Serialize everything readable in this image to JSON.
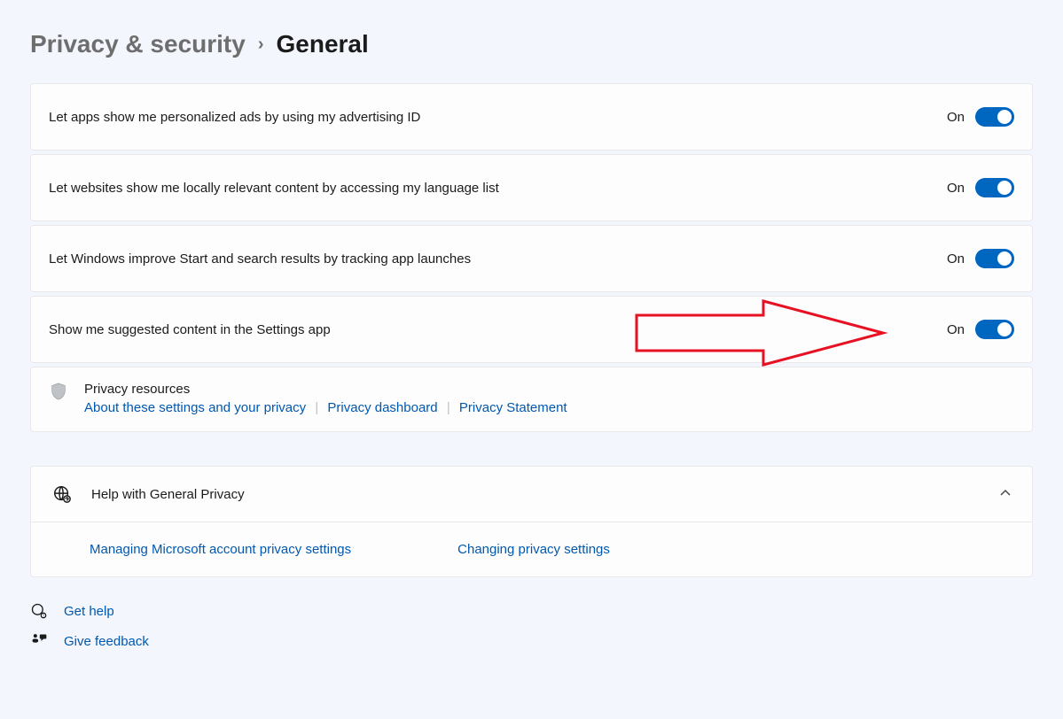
{
  "breadcrumb": {
    "parent": "Privacy & security",
    "current": "General"
  },
  "settings": [
    {
      "label": "Let apps show me personalized ads by using my advertising ID",
      "state": "On",
      "on": true,
      "name": "advertising-id"
    },
    {
      "label": "Let websites show me locally relevant content by accessing my language list",
      "state": "On",
      "on": true,
      "name": "language-list"
    },
    {
      "label": "Let Windows improve Start and search results by tracking app launches",
      "state": "On",
      "on": true,
      "name": "track-app-launches"
    },
    {
      "label": "Show me suggested content in the Settings app",
      "state": "On",
      "on": true,
      "name": "suggested-content"
    }
  ],
  "resources": {
    "title": "Privacy resources",
    "links": [
      "About these settings and your privacy",
      "Privacy dashboard",
      "Privacy Statement"
    ]
  },
  "help": {
    "title": "Help with General Privacy",
    "links": [
      "Managing Microsoft account privacy settings",
      "Changing privacy settings"
    ]
  },
  "footer": {
    "get_help": "Get help",
    "give_feedback": "Give feedback"
  },
  "colors": {
    "accent": "#0067c0",
    "link": "#0058b0",
    "annotation": "#e81123"
  }
}
